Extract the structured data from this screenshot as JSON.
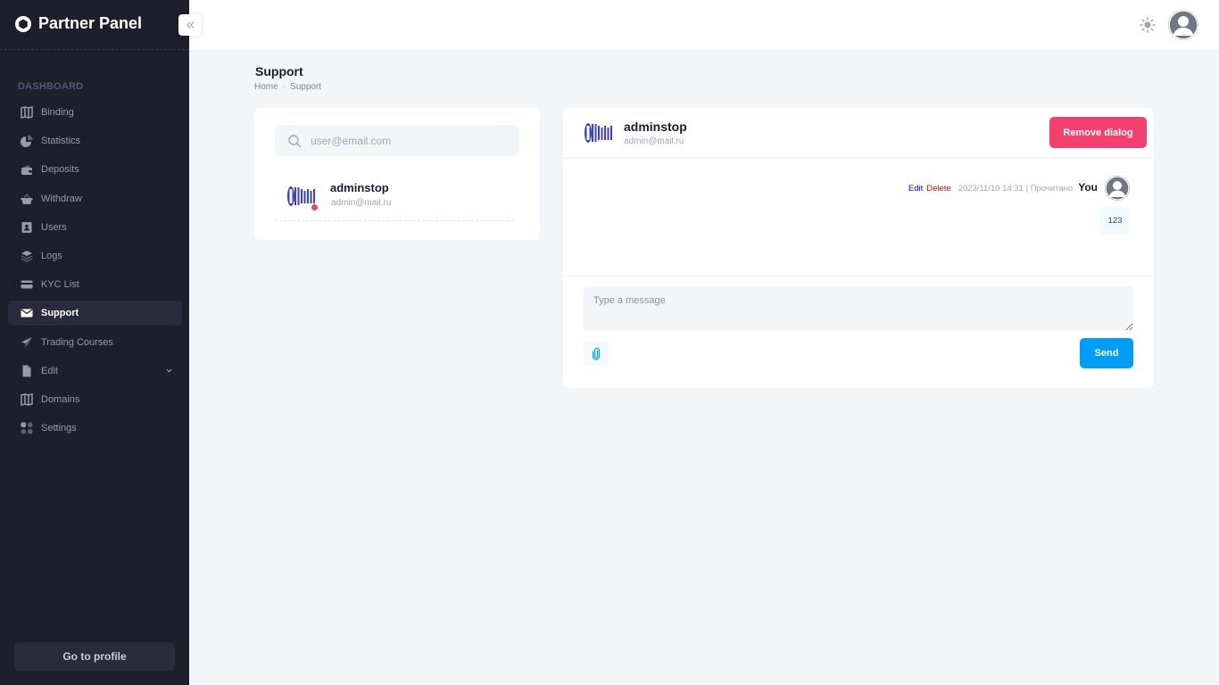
{
  "app": {
    "title": "Partner Panel",
    "brand_color": "#1e1e2d",
    "accent_color": "#009ef7",
    "danger_color": "#f1416c"
  },
  "sidebar": {
    "section_title": "DASHBOARD",
    "items": [
      {
        "label": "Binding",
        "icon": "map-icon",
        "active": false
      },
      {
        "label": "Statistics",
        "icon": "pie-chart-icon",
        "active": false
      },
      {
        "label": "Deposits",
        "icon": "wallet-icon",
        "active": false
      },
      {
        "label": "Withdraw",
        "icon": "basket-icon",
        "active": false
      },
      {
        "label": "Users",
        "icon": "address-book-icon",
        "active": false
      },
      {
        "label": "Logs",
        "icon": "layers-icon",
        "active": false
      },
      {
        "label": "KYC List",
        "icon": "credit-card-icon",
        "active": false
      },
      {
        "label": "Support",
        "icon": "envelope-icon",
        "active": true
      },
      {
        "label": "Trading Courses",
        "icon": "paper-plane-icon",
        "active": false
      },
      {
        "label": "Edit",
        "icon": "file-icon",
        "active": false,
        "has_submenu": true
      },
      {
        "label": "Domains",
        "icon": "map-icon",
        "active": false
      },
      {
        "label": "Settings",
        "icon": "grid-dots-icon",
        "active": false
      }
    ],
    "profile_button": "Go to profile"
  },
  "header": {
    "theme_icon": "sun-icon",
    "avatar_icon": "user-avatar-icon"
  },
  "page": {
    "title": "Support",
    "breadcrumb": [
      "Home",
      "Support"
    ]
  },
  "contacts": {
    "search_placeholder": "user@email.com",
    "items": [
      {
        "name": "adminstop",
        "email": "admin@mail.ru",
        "online": true,
        "logo": "Dubnon-logo"
      }
    ]
  },
  "chat": {
    "name": "adminstop",
    "email": "admin@mail.ru",
    "remove_label": "Remove dialog",
    "messages": [
      {
        "edit_label": "Edit",
        "delete_label": "Delete",
        "time": "2023/11/10 14:31 | Прочитано",
        "author": "You",
        "text": "123"
      }
    ],
    "input_placeholder": "Type a message",
    "attach_icon": "paperclip-icon",
    "send_label": "Send"
  }
}
